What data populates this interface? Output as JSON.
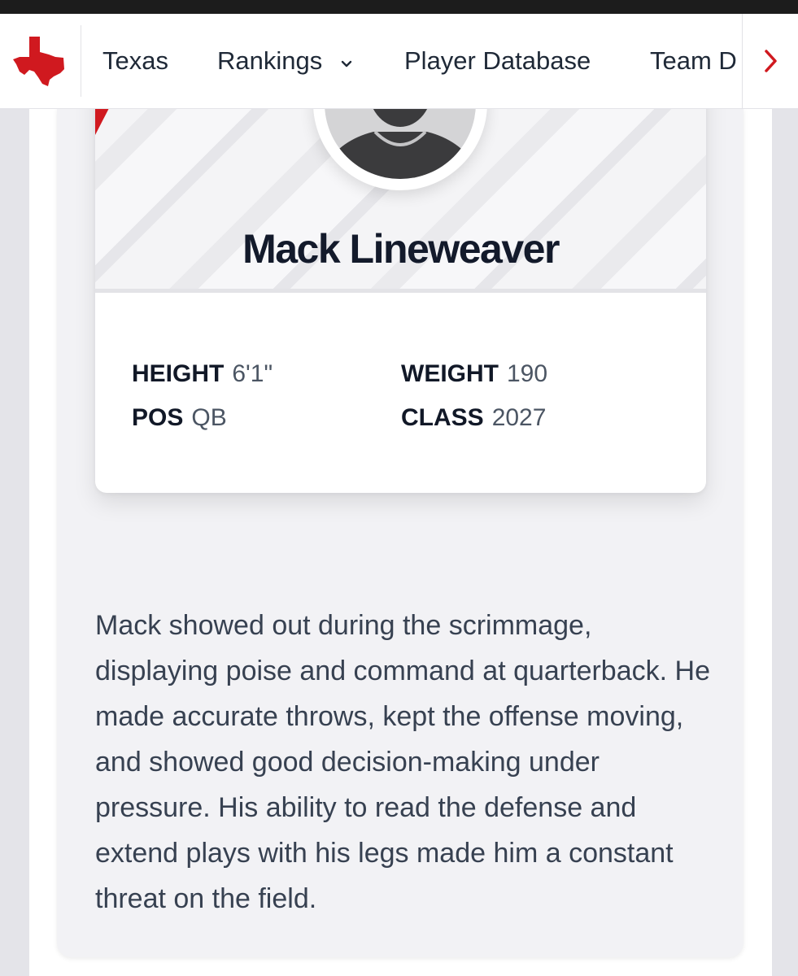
{
  "nav": {
    "items": [
      "Texas",
      "Rankings",
      "Player Database",
      "Team D"
    ],
    "accent": "#d0191f"
  },
  "player": {
    "name": "Mack Lineweaver",
    "stats": [
      {
        "label": "HEIGHT",
        "value": "6'1\""
      },
      {
        "label": "WEIGHT",
        "value": "190"
      },
      {
        "label": "POS",
        "value": "QB"
      },
      {
        "label": "CLASS",
        "value": "2027"
      }
    ],
    "description": "Mack showed out during the scrimmage, displaying poise and command at quarterback. He made accurate throws, kept the offense moving, and showed good decision-making under pressure. His ability to read the defense and extend plays with his legs made him a constant threat on the field."
  },
  "icons": {
    "logo": "texas-state-icon",
    "dropdown": "chevron-down-icon",
    "next": "chevron-right-icon",
    "avatar": "player-silhouette-icon"
  }
}
